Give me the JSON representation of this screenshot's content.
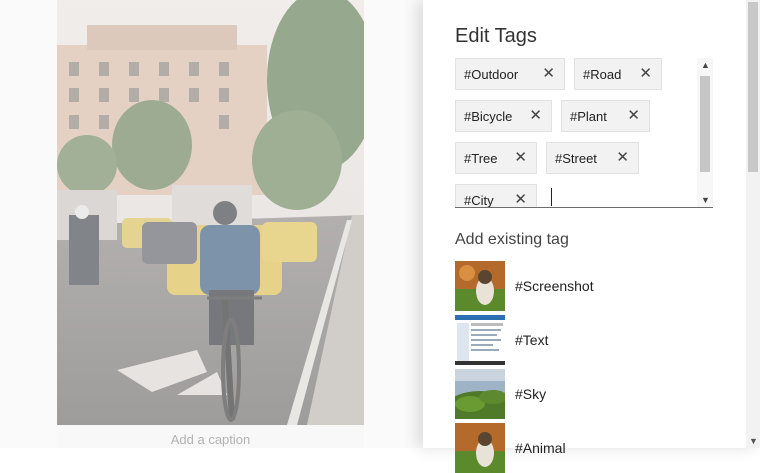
{
  "photo": {
    "caption_placeholder": "Add a caption"
  },
  "edit_panel": {
    "title": "Edit Tags",
    "tags": [
      {
        "label": "#Outdoor"
      },
      {
        "label": "#Road"
      },
      {
        "label": "#Bicycle"
      },
      {
        "label": "#Plant"
      },
      {
        "label": "#Tree"
      },
      {
        "label": "#Street"
      },
      {
        "label": "#City"
      }
    ],
    "remove_icon": "close-icon",
    "existing_heading": "Add existing tag",
    "existing_tags": [
      {
        "label": "#Screenshot",
        "thumbnail": "dog-on-grass"
      },
      {
        "label": "#Text",
        "thumbnail": "app-screenshot"
      },
      {
        "label": "#Sky",
        "thumbnail": "green-hills"
      },
      {
        "label": "#Animal",
        "thumbnail": "dog-on-grass"
      }
    ]
  }
}
